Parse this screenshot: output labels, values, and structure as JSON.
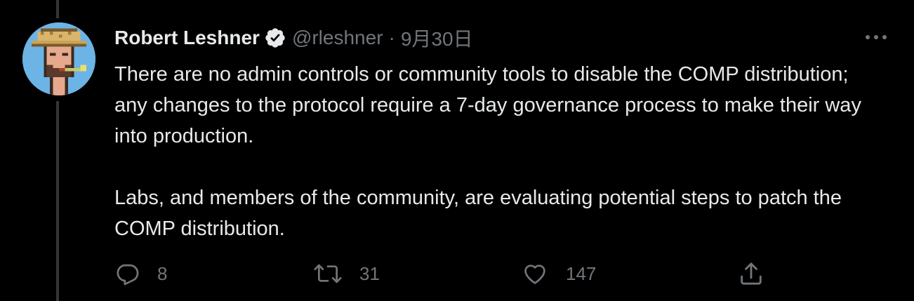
{
  "author": {
    "display_name": "Robert Leshner",
    "handle": "@rleshner",
    "separator": "·",
    "date": "9月30日",
    "verified": true,
    "avatar": "cryptopunk-avatar-with-hat-and-pipe"
  },
  "tweet": {
    "paragraphs": [
      "There are no admin controls or community tools to disable the COMP distribution; any changes to the protocol require a 7-day governance process to make their way into production.",
      "Labs, and members of the community, are evaluating potential steps to patch the COMP distribution."
    ]
  },
  "actions": {
    "reply": {
      "icon": "reply-icon",
      "count": "8"
    },
    "retweet": {
      "icon": "retweet-icon",
      "count": "31"
    },
    "like": {
      "icon": "heart-icon",
      "count": "147"
    },
    "share": {
      "icon": "share-icon"
    }
  },
  "colors": {
    "background": "#000000",
    "primary_text": "#e7e9ea",
    "secondary_text": "#71767b",
    "thread_line": "#333639"
  }
}
